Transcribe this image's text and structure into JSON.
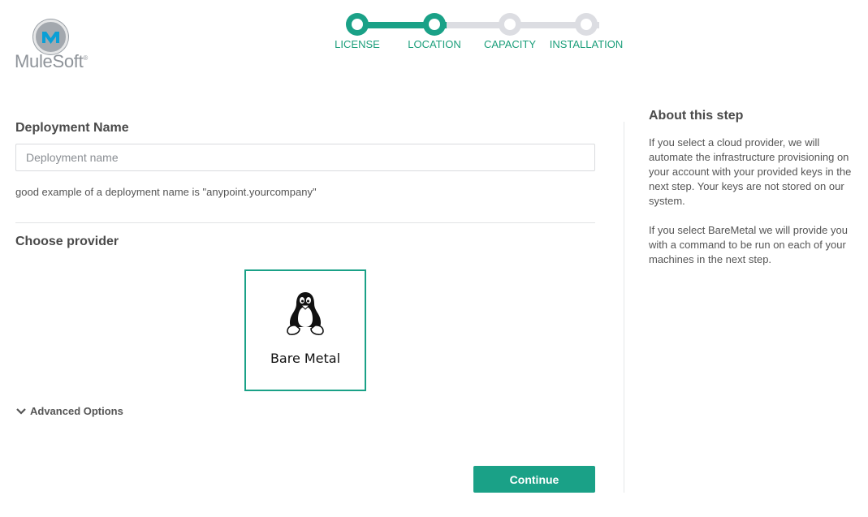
{
  "brand": {
    "name": "MuleSoft",
    "mark": "®",
    "color": "#1aa187"
  },
  "stepper": {
    "steps": [
      {
        "label": "LICENSE",
        "state": "done"
      },
      {
        "label": "LOCATION",
        "state": "current"
      },
      {
        "label": "CAPACITY",
        "state": "todo"
      },
      {
        "label": "INSTALLATION",
        "state": "todo"
      }
    ]
  },
  "main": {
    "deployment_title": "Deployment Name",
    "deployment_placeholder": "Deployment name",
    "deployment_value": "",
    "hint": "good example of a deployment name is \"anypoint.yourcompany\"",
    "provider_title": "Choose provider",
    "providers": [
      {
        "label": "Bare Metal",
        "icon": "linux-tux-icon",
        "selected": true
      }
    ],
    "advanced_label": "Advanced Options",
    "continue_label": "Continue"
  },
  "sidebar": {
    "title": "About this step",
    "para1": "If you select a cloud provider, we will automate the infrastructure provisioning on your account with your provided keys in the next step. Your keys are not stored on our system.",
    "para2": "If you select BareMetal we will provide you with a command to be run on each of your machines in the next step."
  }
}
